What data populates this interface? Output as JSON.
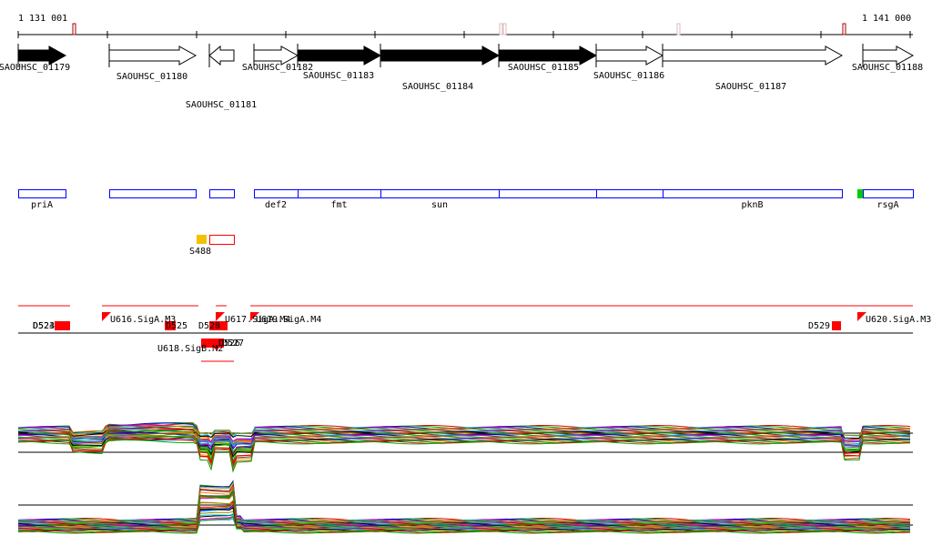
{
  "axis": {
    "start_label": "1 131 001",
    "end_label": "1 141 000"
  },
  "genes": [
    {
      "name": "SAOUHSC_01179",
      "strand": "+",
      "filled": true
    },
    {
      "name": "SAOUHSC_01180",
      "strand": "+",
      "filled": false
    },
    {
      "name": "SAOUHSC_01181",
      "strand": "-",
      "filled": false
    },
    {
      "name": "SAOUHSC_01182",
      "strand": "+",
      "filled": false
    },
    {
      "name": "SAOUHSC_01183",
      "strand": "+",
      "filled": true
    },
    {
      "name": "SAOUHSC_01184",
      "strand": "+",
      "filled": true
    },
    {
      "name": "SAOUHSC_01185",
      "strand": "+",
      "filled": true
    },
    {
      "name": "SAOUHSC_01186",
      "strand": "+",
      "filled": false
    },
    {
      "name": "SAOUHSC_01187",
      "strand": "+",
      "filled": false
    },
    {
      "name": "SAOUHSC_01188",
      "strand": "+",
      "filled": false
    }
  ],
  "gene_symbols": [
    "priA",
    "",
    "",
    "def2",
    "fmt",
    "sun",
    "",
    "",
    "pknB",
    "rsgA"
  ],
  "srna": {
    "label": "S488"
  },
  "features": [
    "D523",
    "D524",
    "U616.SigA.M3",
    "D525",
    "D528",
    "U617.SigA.M4",
    "U619.SigA.M4",
    "U618.SigB.M2",
    "D526",
    "D527",
    "D529",
    "U620.SigA.M3"
  ],
  "colors": {
    "feature": "#ff0000",
    "orthology": "#0000ff",
    "srna": "#f5c000",
    "extra": "#00cc00"
  }
}
